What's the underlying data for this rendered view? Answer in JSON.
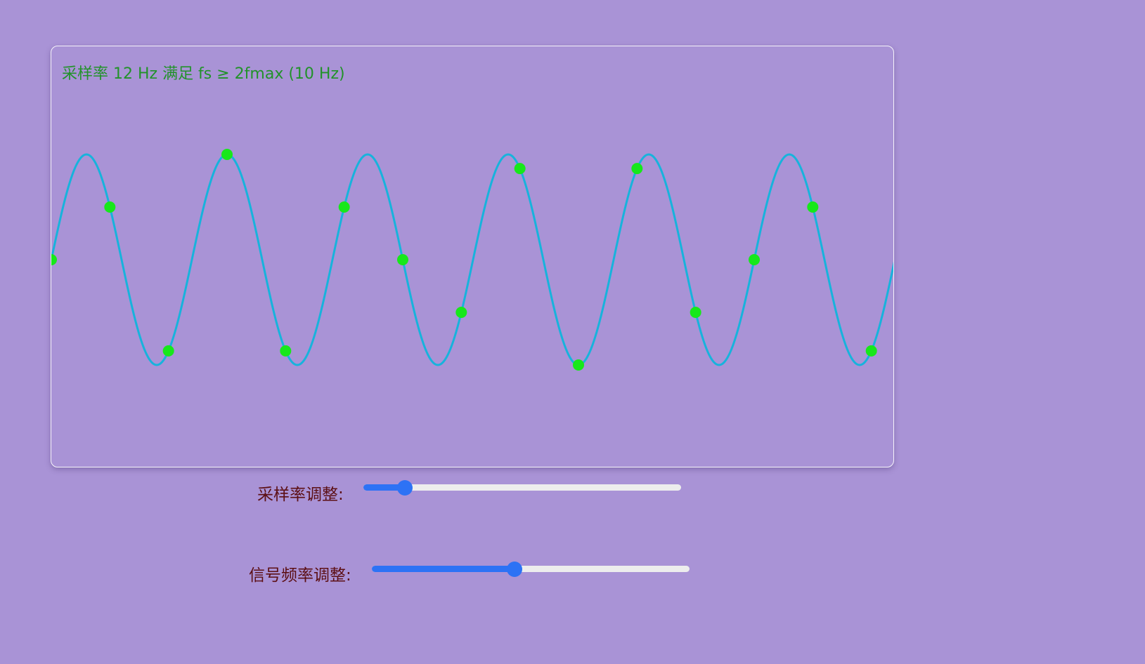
{
  "status": {
    "text": "采样率 12 Hz 满足 fs ≥ 2fmax (10 Hz)",
    "color": "#22922a"
  },
  "chart_data": {
    "type": "line",
    "signal_frequency_hz": 5,
    "sample_rate_hz": 12,
    "duration_s": 1.2,
    "signal_color": "#17b3dc",
    "sample_color": "#17e81a"
  },
  "controls": {
    "sample_rate": {
      "label": "采样率调整:",
      "level_percent": 13
    },
    "signal_frequency": {
      "label": "信号频率调整:",
      "level_percent": 45
    }
  },
  "colors": {
    "background": "#a993d6",
    "slider_accent": "#2d72f5",
    "label_text": "#5c0f14"
  }
}
